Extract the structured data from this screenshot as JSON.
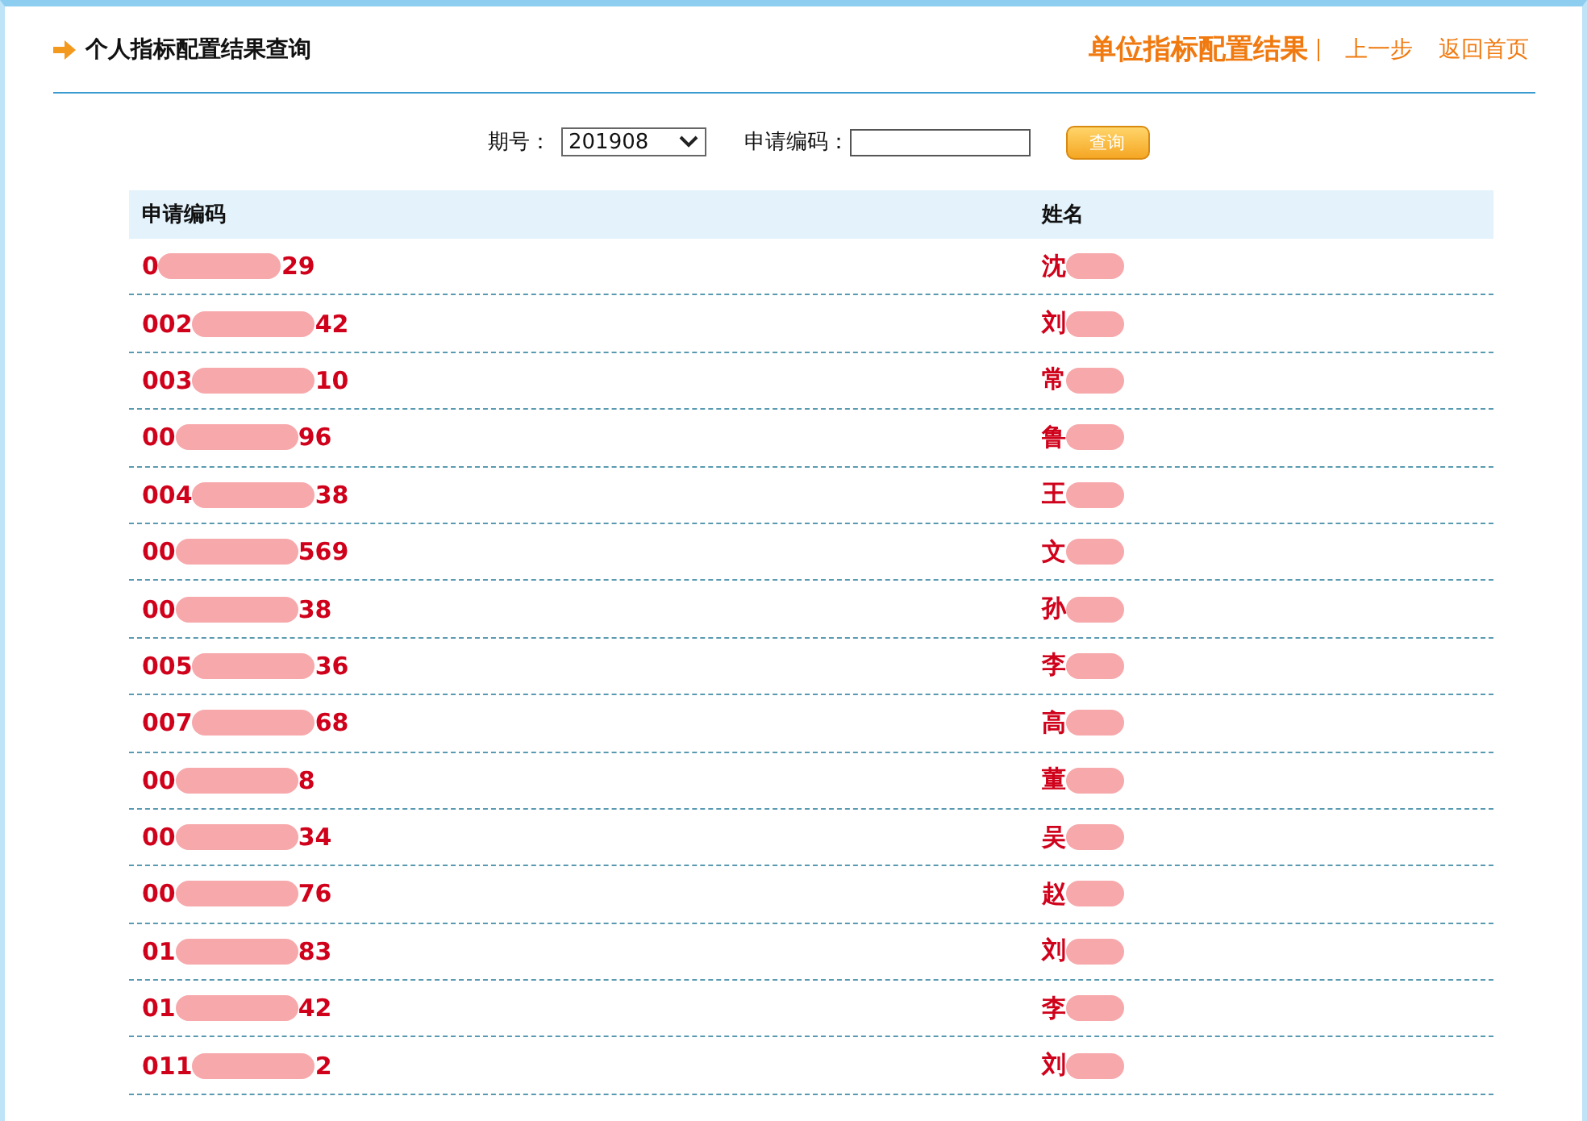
{
  "header": {
    "title": "个人指标配置结果查询",
    "links": [
      {
        "label": "单位指标配置结果",
        "kind": "strong"
      },
      {
        "label": "上一步",
        "kind": "plain"
      },
      {
        "label": "返回首页",
        "kind": "plain"
      }
    ]
  },
  "search": {
    "period_label": "期号：",
    "period_value": "201908",
    "code_label": "申请编码：",
    "button": "查询"
  },
  "table": {
    "columns": [
      "申请编码",
      "姓名"
    ],
    "rows": [
      {
        "code_start": "0",
        "code_end": "29",
        "name": "沈"
      },
      {
        "code_start": "002",
        "code_end": "42",
        "name": "刘"
      },
      {
        "code_start": "003",
        "code_end": "10",
        "name": "常"
      },
      {
        "code_start": "00",
        "code_end": "96",
        "name": "鲁"
      },
      {
        "code_start": "004",
        "code_end": "38",
        "name": "王"
      },
      {
        "code_start": "00",
        "code_end": "569",
        "name": "文"
      },
      {
        "code_start": "00",
        "code_end": "38",
        "name": "孙"
      },
      {
        "code_start": "005",
        "code_end": "36",
        "name": "李"
      },
      {
        "code_start": "007",
        "code_end": "68",
        "name": "高"
      },
      {
        "code_start": "00",
        "code_end": "8",
        "name": "董"
      },
      {
        "code_start": "00",
        "code_end": "34",
        "name": "吴"
      },
      {
        "code_start": "00",
        "code_end": "76",
        "name": "赵"
      },
      {
        "code_start": "01",
        "code_end": "83",
        "name": "刘"
      },
      {
        "code_start": "01",
        "code_end": "42",
        "name": "李"
      },
      {
        "code_start": "011",
        "code_end": "2",
        "name": "刘"
      }
    ]
  }
}
